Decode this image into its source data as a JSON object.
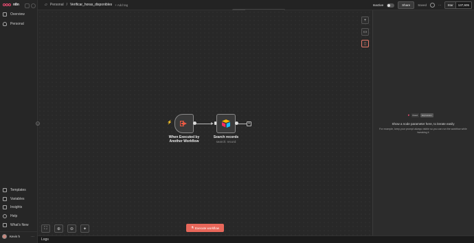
{
  "sidebar": {
    "logo": "n8n",
    "items": [
      {
        "label": "Overview",
        "icon": "home-icon"
      },
      {
        "label": "Personal",
        "icon": "user-icon"
      }
    ],
    "bottom_items": [
      {
        "label": "Templates",
        "icon": "templates-icon"
      },
      {
        "label": "Variables",
        "icon": "variables-icon"
      },
      {
        "label": "Insights",
        "icon": "insights-icon"
      },
      {
        "label": "Help",
        "icon": "help-icon"
      },
      {
        "label": "What's New",
        "icon": "gift-icon"
      }
    ],
    "user_name": "Kevin h"
  },
  "header": {
    "breadcrumb_root": "Personal",
    "separator": "/",
    "workflow_name": "Verificar_horas_disponibles",
    "add_tag": "+ Add tag",
    "status": "Inactive",
    "share": "Share",
    "saved": "Saved",
    "github_star": "Star",
    "github_count": "137,605"
  },
  "tabs": [
    "Editor",
    "Executions",
    "Evaluations"
  ],
  "nodes": {
    "trigger": {
      "title": "When Executed by Another Workflow"
    },
    "action": {
      "title": "Search records",
      "subtitle": "search: record"
    }
  },
  "canvas": {
    "execute_label": "Execute workflow",
    "plus": "+"
  },
  "panel": {
    "chip_fixed": "Fixed",
    "chip_expression": "Expression",
    "title": "Show a node parameter here, to iterate easily",
    "body": "For example, keep your prompt always visible so you can run the workflow while tweaking it"
  },
  "bottom": {
    "label": "Logs"
  },
  "colors": {
    "accent": "#ea4b71",
    "execute": "#e8675a"
  }
}
